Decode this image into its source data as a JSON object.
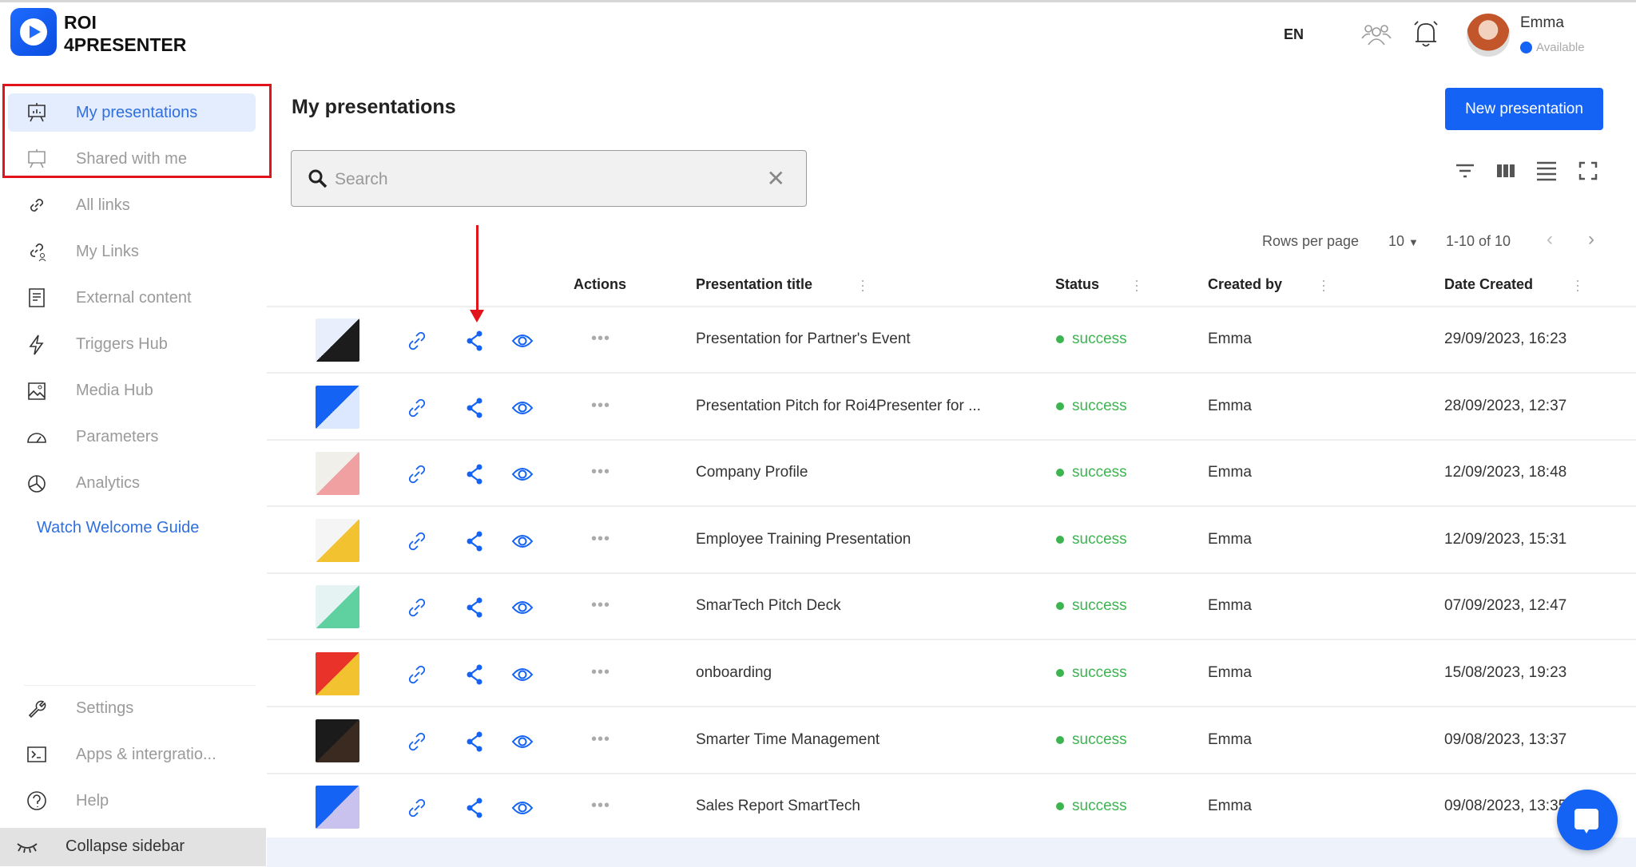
{
  "brand": {
    "line1": "ROI",
    "line2": "4PRESENTER"
  },
  "header": {
    "language": "EN",
    "user": {
      "name": "Emma",
      "status": "Available",
      "status_color": "#1463f5"
    }
  },
  "sidebar": {
    "items": [
      {
        "label": "My presentations",
        "icon": "presentation-board-icon",
        "active": true
      },
      {
        "label": "Shared with me",
        "icon": "shared-board-icon"
      },
      {
        "label": "All links",
        "icon": "link-icon"
      },
      {
        "label": "My Links",
        "icon": "user-link-icon"
      },
      {
        "label": "External content",
        "icon": "document-icon"
      },
      {
        "label": "Triggers Hub",
        "icon": "lightning-icon"
      },
      {
        "label": "Media Hub",
        "icon": "image-icon"
      },
      {
        "label": "Parameters",
        "icon": "gauge-icon"
      },
      {
        "label": "Analytics",
        "icon": "pie-chart-icon"
      }
    ],
    "welcome_guide": "Watch Welcome Guide",
    "bottom_items": [
      {
        "label": "Settings",
        "icon": "wrench-icon"
      },
      {
        "label": "Apps & intergratio...",
        "icon": "terminal-icon"
      },
      {
        "label": "Help",
        "icon": "help-icon"
      }
    ],
    "collapse": "Collapse sidebar"
  },
  "main": {
    "title": "My presentations",
    "new_button": "New presentation",
    "search": {
      "placeholder": "Search",
      "value": ""
    },
    "pagination": {
      "rows_label": "Rows per page",
      "rows_value": "10",
      "range": "1-10 of 10"
    },
    "columns": {
      "actions": "Actions",
      "title": "Presentation title",
      "status": "Status",
      "created_by": "Created by",
      "date": "Date Created"
    },
    "rows": [
      {
        "title": "Presentation for Partner's Event",
        "status": "success",
        "created_by": "Emma",
        "date": "29/09/2023, 16:23",
        "thumb": [
          "#e8eefc",
          "#1c1c1c"
        ]
      },
      {
        "title": "Presentation Pitch for Roi4Presenter for ...",
        "status": "success",
        "created_by": "Emma",
        "date": "28/09/2023, 12:37",
        "thumb": [
          "#1463f5",
          "#dbe8ff"
        ]
      },
      {
        "title": "Company Profile",
        "status": "success",
        "created_by": "Emma",
        "date": "12/09/2023, 18:48",
        "thumb": [
          "#f1efea",
          "#f0a0a0"
        ]
      },
      {
        "title": "Employee Training Presentation",
        "status": "success",
        "created_by": "Emma",
        "date": "12/09/2023, 15:31",
        "thumb": [
          "#f5f5f5",
          "#f2c230"
        ]
      },
      {
        "title": "SmarTech Pitch Deck",
        "status": "success",
        "created_by": "Emma",
        "date": "07/09/2023, 12:47",
        "thumb": [
          "#e6f3f3",
          "#5fd0a0"
        ]
      },
      {
        "title": "onboarding",
        "status": "success",
        "created_by": "Emma",
        "date": "15/08/2023, 19:23",
        "thumb": [
          "#e8322a",
          "#f2c230"
        ]
      },
      {
        "title": "Smarter Time Management",
        "status": "success",
        "created_by": "Emma",
        "date": "09/08/2023, 13:37",
        "thumb": [
          "#1b1b1b",
          "#3a2a20"
        ]
      },
      {
        "title": "Sales Report SmartTech",
        "status": "success",
        "created_by": "Emma",
        "date": "09/08/2023, 13:35",
        "thumb": [
          "#1463f5",
          "#c9c2ef"
        ]
      }
    ]
  },
  "colors": {
    "accent": "#1463f5",
    "success": "#3cb550",
    "highlight": "#e0141a"
  }
}
